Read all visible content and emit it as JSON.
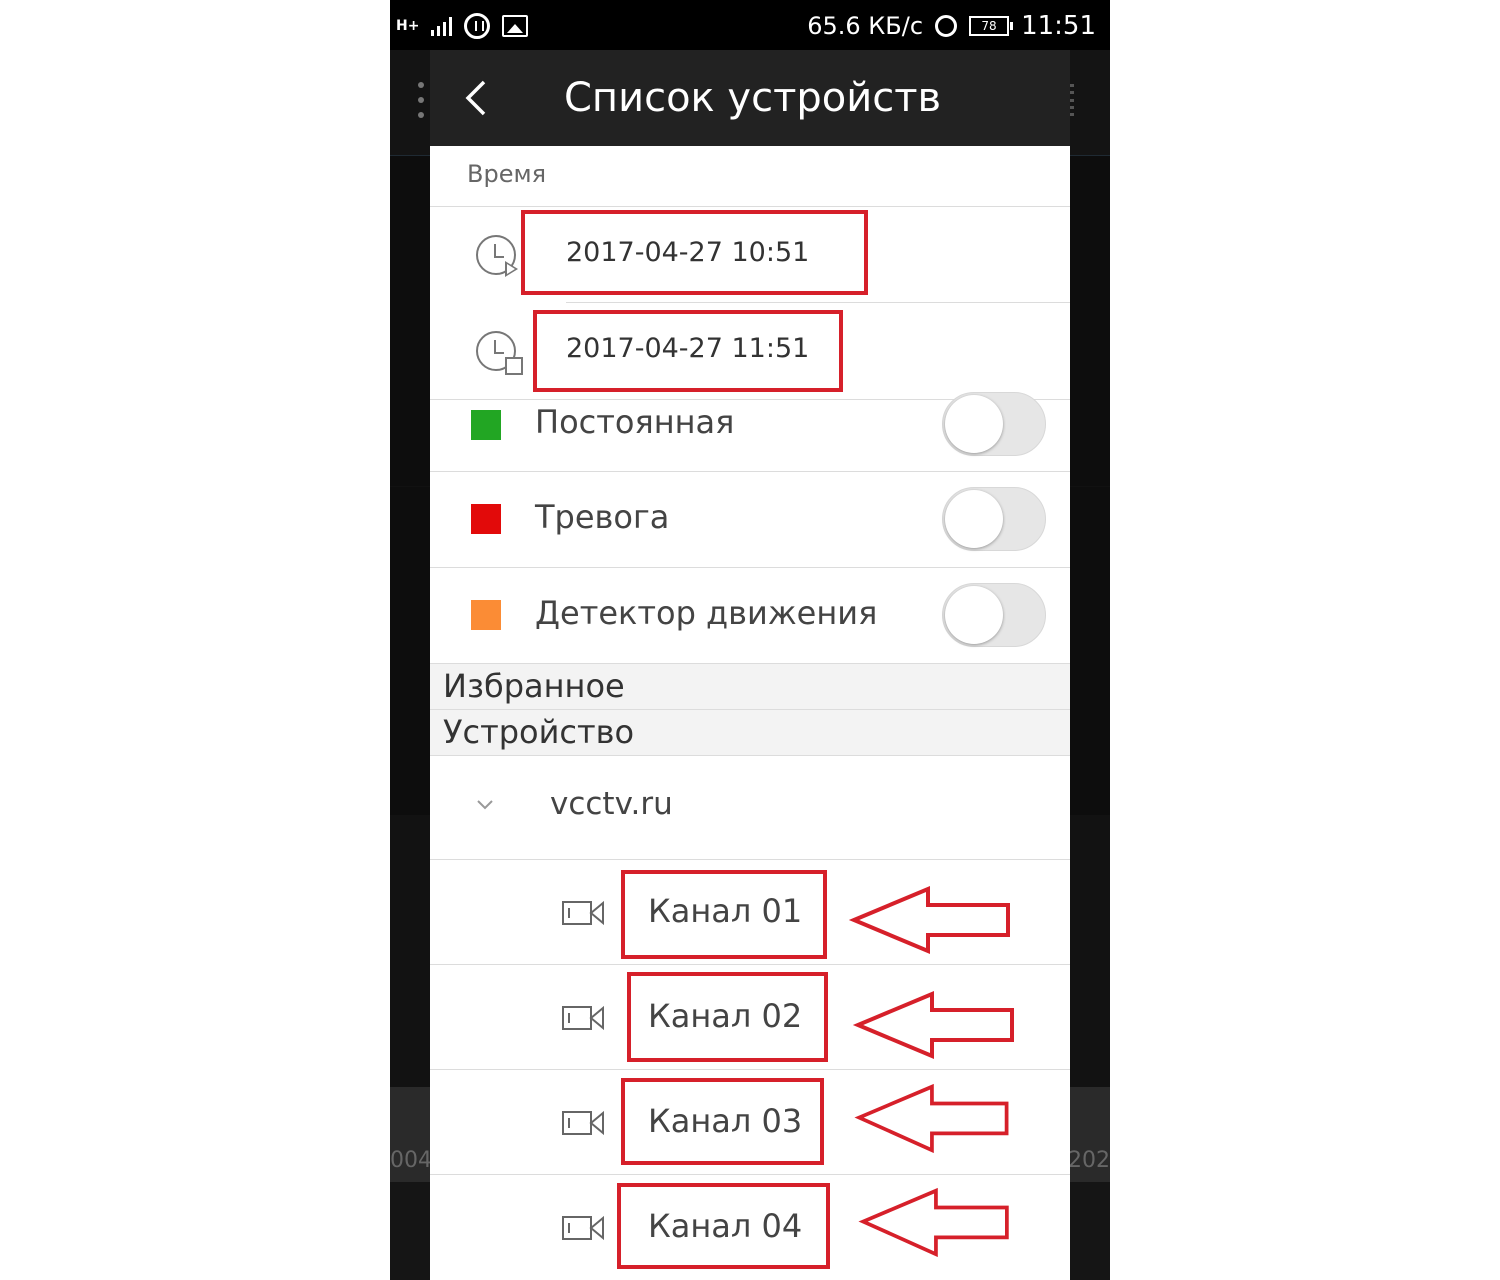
{
  "status_bar": {
    "network": "H+",
    "speed": "65.6 КБ/с",
    "battery": "78",
    "time": "11:51"
  },
  "background_app": {
    "left_number": "004",
    "right_number": "202"
  },
  "header": {
    "title": "Список устройств"
  },
  "time_section": {
    "label": "Время",
    "start": "2017-04-27 10:51",
    "end": "2017-04-27 11:51"
  },
  "filters": [
    {
      "label": "Постоянная",
      "color": "#22a623",
      "enabled": false
    },
    {
      "label": "Тревога",
      "color": "#e20a0a",
      "enabled": false
    },
    {
      "label": "Детектор движения",
      "color": "#fb8c35",
      "enabled": false
    }
  ],
  "groups": {
    "favorites": "Избранное",
    "devices": "Устройство"
  },
  "device": {
    "name": "vcctv.ru",
    "channels": [
      "Канал 01",
      "Канал 02",
      "Канал 03",
      "Канал 04"
    ]
  },
  "colors": {
    "annotation_red": "#d6202a",
    "header_bg": "#222222"
  },
  "icons": {
    "back": "back-arrow-icon",
    "start_time": "clock-play-icon",
    "end_time": "clock-stop-icon",
    "expand": "chevron-down-icon",
    "camera": "video-camera-icon"
  }
}
